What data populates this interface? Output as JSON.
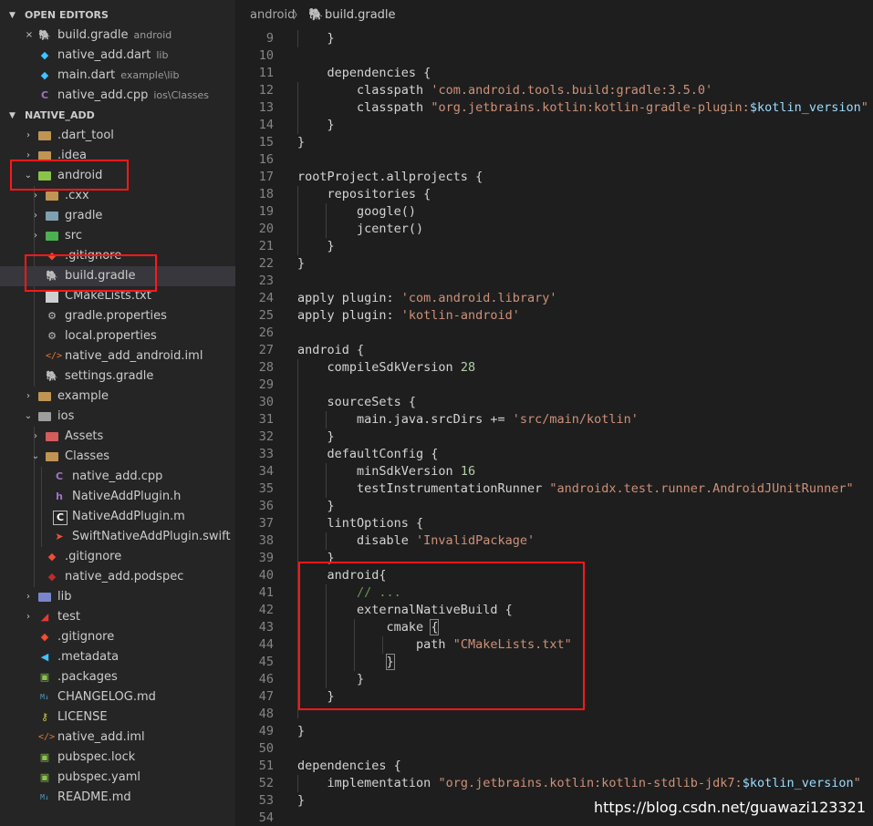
{
  "sidebar": {
    "open_editors_header": "OPEN EDITORS",
    "open_editors": [
      {
        "name": "build.gradle",
        "desc": "android",
        "icon": "gradle-icon",
        "close": "×"
      },
      {
        "name": "native_add.dart",
        "desc": "lib",
        "icon": "dart-icon"
      },
      {
        "name": "main.dart",
        "desc": "example\\lib",
        "icon": "dart-icon"
      },
      {
        "name": "native_add.cpp",
        "desc": "ios\\Classes",
        "icon": "cpp-icon"
      }
    ],
    "project_header": "NATIVE_ADD",
    "tree": [
      {
        "name": ".dart_tool"
      },
      {
        "name": ".idea"
      },
      {
        "name": "android"
      },
      {
        "name": ".cxx"
      },
      {
        "name": "gradle"
      },
      {
        "name": "src"
      },
      {
        "name": ".gitignore"
      },
      {
        "name": "build.gradle"
      },
      {
        "name": "CMakeLists.txt"
      },
      {
        "name": "gradle.properties"
      },
      {
        "name": "local.properties"
      },
      {
        "name": "native_add_android.iml"
      },
      {
        "name": "settings.gradle"
      },
      {
        "name": "example"
      },
      {
        "name": "ios"
      },
      {
        "name": "Assets"
      },
      {
        "name": "Classes"
      },
      {
        "name": "native_add.cpp"
      },
      {
        "name": "NativeAddPlugin.h"
      },
      {
        "name": "NativeAddPlugin.m"
      },
      {
        "name": "SwiftNativeAddPlugin.swift"
      },
      {
        "name": ".gitignore"
      },
      {
        "name": "native_add.podspec"
      },
      {
        "name": "lib"
      },
      {
        "name": "test"
      },
      {
        "name": ".gitignore"
      },
      {
        "name": ".metadata"
      },
      {
        "name": ".packages"
      },
      {
        "name": "CHANGELOG.md"
      },
      {
        "name": "LICENSE"
      },
      {
        "name": "native_add.iml"
      },
      {
        "name": "pubspec.lock"
      },
      {
        "name": "pubspec.yaml"
      },
      {
        "name": "README.md"
      }
    ]
  },
  "breadcrumb": {
    "folder": "android",
    "file": "build.gradle"
  },
  "code_lines": [
    {
      "n": "9",
      "t": [
        [
          "    }",
          "p"
        ]
      ]
    },
    {
      "n": "10",
      "t": []
    },
    {
      "n": "11",
      "t": [
        [
          "    dependencies {",
          "p"
        ]
      ]
    },
    {
      "n": "12",
      "t": [
        [
          "        classpath ",
          "p"
        ],
        [
          "'com.android.tools.build:gradle:3.5.0'",
          "s"
        ]
      ]
    },
    {
      "n": "13",
      "t": [
        [
          "        classpath ",
          "p"
        ],
        [
          "\"org.jetbrains.kotlin:kotlin-gradle-plugin:",
          "s"
        ],
        [
          "$kotlin_version",
          "v"
        ],
        [
          "\"",
          "s"
        ]
      ]
    },
    {
      "n": "14",
      "t": [
        [
          "    }",
          "p"
        ]
      ]
    },
    {
      "n": "15",
      "t": [
        [
          "}",
          "p"
        ]
      ]
    },
    {
      "n": "16",
      "t": []
    },
    {
      "n": "17",
      "t": [
        [
          "rootProject.allprojects {",
          "p"
        ]
      ]
    },
    {
      "n": "18",
      "t": [
        [
          "    repositories {",
          "p"
        ]
      ]
    },
    {
      "n": "19",
      "t": [
        [
          "        google()",
          "p"
        ]
      ]
    },
    {
      "n": "20",
      "t": [
        [
          "        jcenter()",
          "p"
        ]
      ]
    },
    {
      "n": "21",
      "t": [
        [
          "    }",
          "p"
        ]
      ]
    },
    {
      "n": "22",
      "t": [
        [
          "}",
          "p"
        ]
      ]
    },
    {
      "n": "23",
      "t": []
    },
    {
      "n": "24",
      "t": [
        [
          "apply plugin: ",
          "p"
        ],
        [
          "'com.android.library'",
          "s"
        ]
      ]
    },
    {
      "n": "25",
      "t": [
        [
          "apply plugin: ",
          "p"
        ],
        [
          "'kotlin-android'",
          "s"
        ]
      ]
    },
    {
      "n": "26",
      "t": []
    },
    {
      "n": "27",
      "t": [
        [
          "android {",
          "p"
        ]
      ]
    },
    {
      "n": "28",
      "t": [
        [
          "    compileSdkVersion ",
          "p"
        ],
        [
          "28",
          "n"
        ]
      ]
    },
    {
      "n": "29",
      "t": []
    },
    {
      "n": "30",
      "t": [
        [
          "    sourceSets {",
          "p"
        ]
      ]
    },
    {
      "n": "31",
      "t": [
        [
          "        main.java.srcDirs += ",
          "p"
        ],
        [
          "'src/main/kotlin'",
          "s"
        ]
      ]
    },
    {
      "n": "32",
      "t": [
        [
          "    }",
          "p"
        ]
      ]
    },
    {
      "n": "33",
      "t": [
        [
          "    defaultConfig {",
          "p"
        ]
      ]
    },
    {
      "n": "34",
      "t": [
        [
          "        minSdkVersion ",
          "p"
        ],
        [
          "16",
          "n"
        ]
      ]
    },
    {
      "n": "35",
      "t": [
        [
          "        testInstrumentationRunner ",
          "p"
        ],
        [
          "\"androidx.test.runner.AndroidJUnitRunner\"",
          "s"
        ]
      ]
    },
    {
      "n": "36",
      "t": [
        [
          "    }",
          "p"
        ]
      ]
    },
    {
      "n": "37",
      "t": [
        [
          "    lintOptions {",
          "p"
        ]
      ]
    },
    {
      "n": "38",
      "t": [
        [
          "        disable ",
          "p"
        ],
        [
          "'InvalidPackage'",
          "s"
        ]
      ]
    },
    {
      "n": "39",
      "t": [
        [
          "    }",
          "p"
        ]
      ]
    },
    {
      "n": "40",
      "t": [
        [
          "    android{",
          "p"
        ]
      ]
    },
    {
      "n": "41",
      "t": [
        [
          "        // ...",
          "c"
        ]
      ]
    },
    {
      "n": "42",
      "t": [
        [
          "        externalNativeBuild {",
          "p"
        ]
      ]
    },
    {
      "n": "43",
      "t": [
        [
          "            cmake ",
          "p"
        ],
        [
          "{",
          "b"
        ]
      ]
    },
    {
      "n": "44",
      "t": [
        [
          "                path ",
          "p"
        ],
        [
          "\"CMakeLists.txt\"",
          "s"
        ]
      ]
    },
    {
      "n": "45",
      "t": [
        [
          "            ",
          "p"
        ],
        [
          "}",
          "b"
        ]
      ]
    },
    {
      "n": "46",
      "t": [
        [
          "        }",
          "p"
        ]
      ]
    },
    {
      "n": "47",
      "t": [
        [
          "    }",
          "p"
        ]
      ]
    },
    {
      "n": "48",
      "t": []
    },
    {
      "n": "49",
      "t": [
        [
          "}",
          "p"
        ]
      ]
    },
    {
      "n": "50",
      "t": []
    },
    {
      "n": "51",
      "t": [
        [
          "dependencies {",
          "p"
        ]
      ]
    },
    {
      "n": "52",
      "t": [
        [
          "    implementation ",
          "p"
        ],
        [
          "\"org.jetbrains.kotlin:kotlin-stdlib-jdk7:",
          "s"
        ],
        [
          "$kotlin_version",
          "v"
        ],
        [
          "\"",
          "s"
        ]
      ]
    },
    {
      "n": "53",
      "t": [
        [
          "}",
          "p"
        ]
      ]
    },
    {
      "n": "54",
      "t": []
    }
  ],
  "watermark": "https://blog.csdn.net/guawazi123321",
  "colors": {
    "string": "#ce9178",
    "variable": "#9cdcfe",
    "number": "#b5cea8",
    "comment": "#6a9955",
    "annotation": "#ff1818"
  }
}
